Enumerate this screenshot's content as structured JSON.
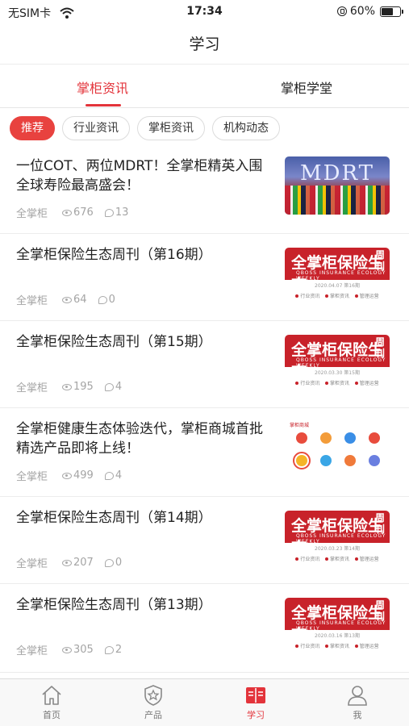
{
  "status": {
    "carrier": "无SIM卡",
    "time": "17:34",
    "battery": "60%"
  },
  "nav": {
    "title": "学习"
  },
  "tabs": [
    {
      "label": "掌柜资讯",
      "active": true
    },
    {
      "label": "掌柜学堂",
      "active": false
    }
  ],
  "chips": [
    {
      "label": "推荐",
      "active": true
    },
    {
      "label": "行业资讯",
      "active": false
    },
    {
      "label": "掌柜资讯",
      "active": false
    },
    {
      "label": "机构动态",
      "active": false
    }
  ],
  "articles": [
    {
      "title": "一位COT、两位MDRT！全掌柜精英入围全球寿险最高盛会！",
      "source": "全掌柜",
      "views": "676",
      "comments": "13",
      "thumb": "mdrt",
      "thumb_text": "MDRT"
    },
    {
      "title": "全掌柜保险生态周刊（第16期）",
      "source": "全掌柜",
      "views": "64",
      "comments": "0",
      "thumb": "weekly"
    },
    {
      "title": "全掌柜保险生态周刊（第15期）",
      "source": "全掌柜",
      "views": "195",
      "comments": "4",
      "thumb": "weekly"
    },
    {
      "title": "全掌柜健康生态体验迭代，掌柜商城首批精选产品即将上线！",
      "source": "全掌柜",
      "views": "499",
      "comments": "4",
      "thumb": "appgrid"
    },
    {
      "title": "全掌柜保险生态周刊（第14期）",
      "source": "全掌柜",
      "views": "207",
      "comments": "0",
      "thumb": "weekly"
    },
    {
      "title": "全掌柜保险生态周刊（第13期）",
      "source": "全掌柜",
      "views": "305",
      "comments": "2",
      "thumb": "weekly"
    }
  ],
  "weekly_thumb": {
    "headline": "全掌柜保险生态",
    "side": "周刊",
    "english": "QBOSS INSURANCE ECOLOGY WEEKLY"
  },
  "tabbar": [
    {
      "label": "首页",
      "icon": "home-icon",
      "active": false
    },
    {
      "label": "产品",
      "icon": "shield-star-icon",
      "active": false
    },
    {
      "label": "学习",
      "icon": "book-icon",
      "active": true
    },
    {
      "label": "我",
      "icon": "person-icon",
      "active": false
    }
  ],
  "colors": {
    "accent": "#e3343b",
    "chip_active": "#e8423f",
    "meta_gray": "#a4a4a4"
  }
}
